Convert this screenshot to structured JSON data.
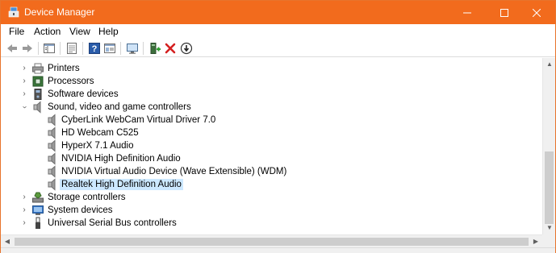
{
  "window": {
    "title": "Device Manager",
    "accent_color": "#f26b1d",
    "controls": {
      "minimize": "minimize-icon",
      "maximize": "maximize-icon",
      "close": "close-icon"
    }
  },
  "menu": {
    "file": "File",
    "action": "Action",
    "view": "View",
    "help": "Help"
  },
  "toolbar": {
    "buttons": [
      "back-arrow-icon",
      "forward-arrow-icon",
      "show-hide-console-tree-icon",
      "properties-icon",
      "help-icon",
      "device-list-icon",
      "scan-for-hardware-changes-icon",
      "add-driver-icon",
      "uninstall-device-icon",
      "update-driver-icon"
    ]
  },
  "tree": {
    "nodes": [
      {
        "label": "Printers",
        "icon": "printer-icon",
        "expanded": false,
        "level": 0
      },
      {
        "label": "Processors",
        "icon": "processor-icon",
        "expanded": false,
        "level": 0
      },
      {
        "label": "Software devices",
        "icon": "software-device-icon",
        "expanded": false,
        "level": 0
      },
      {
        "label": "Sound, video and game controllers",
        "icon": "speaker-icon",
        "expanded": true,
        "level": 0
      },
      {
        "label": "CyberLink WebCam Virtual Driver 7.0",
        "icon": "speaker-icon",
        "level": 1
      },
      {
        "label": "HD Webcam C525",
        "icon": "speaker-icon",
        "level": 1
      },
      {
        "label": "HyperX 7.1 Audio",
        "icon": "speaker-icon",
        "level": 1
      },
      {
        "label": "NVIDIA High Definition Audio",
        "icon": "speaker-icon",
        "level": 1
      },
      {
        "label": "NVIDIA Virtual Audio Device (Wave Extensible) (WDM)",
        "icon": "speaker-icon",
        "level": 1
      },
      {
        "label": "Realtek High Definition Audio",
        "icon": "speaker-icon",
        "level": 1,
        "selected": true
      },
      {
        "label": "Storage controllers",
        "icon": "storage-controller-icon",
        "expanded": false,
        "level": 0
      },
      {
        "label": "System devices",
        "icon": "system-device-icon",
        "expanded": false,
        "level": 0
      },
      {
        "label": "Universal Serial Bus controllers",
        "icon": "usb-icon",
        "expanded": false,
        "level": 0
      }
    ]
  },
  "colors": {
    "selection": "#cce8ff"
  }
}
